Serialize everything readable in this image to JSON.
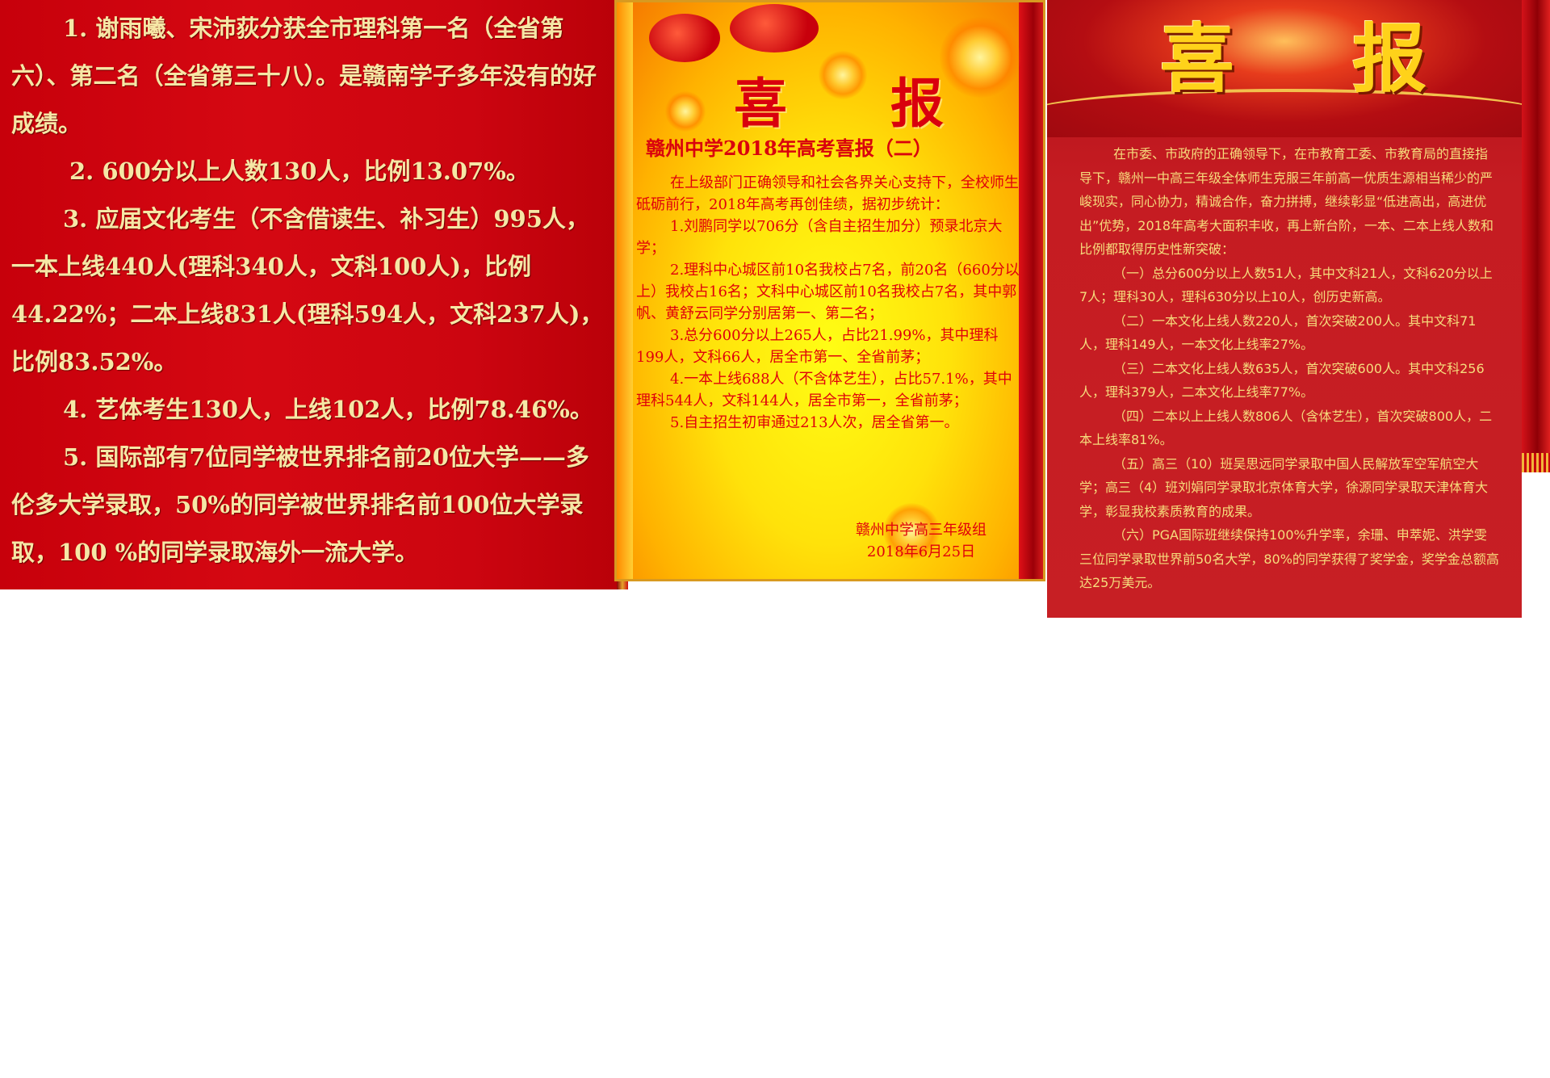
{
  "panel1": {
    "lines": [
      "1. 谢雨曦、宋沛荻分获全市理科第一名（全省第六）、第二名（全省第三十八）。是赣南学子多年没有的好成绩。",
      "2. 600分以上人数130人，比例13.07%。",
      "3. 应届文化考生（不含借读生、补习生）995人，一本上线440人(理科340人，文科100人)，比例44.22%；二本上线831人(理科594人，文科237人)，比例83.52%。",
      "4. 艺体考生130人，上线102人，比例78.46%。",
      "5. 国际部有7位同学被世界排名前20位大学——多伦多大学录取，50%的同学被世界排名前100位大学录取，100 %的同学录取海外一流大学。"
    ]
  },
  "panel2": {
    "header": [
      "喜",
      "报"
    ],
    "subtitle": "赣州中学2018年高考喜报（二）",
    "paragraphs": [
      "在上级部门正确领导和社会各界关心支持下，全校师生砥砺前行，2018年高考再创佳绩，据初步统计：",
      "1.刘鹏同学以706分（含自主招生加分）预录北京大学；",
      "2.理科中心城区前10名我校占7名，前20名（660分以上）我校占16名；文科中心城区前10名我校占7名，其中郭帆、黄舒云同学分别居第一、第二名；",
      "3.总分600分以上265人，占比21.99%，其中理科199人，文科66人，居全市第一、全省前茅；",
      "4.一本上线688人（不含体艺生），占比57.1%，其中理科544人，文科144人，居全市第一，全省前茅；",
      "5.自主招生初审通过213人次，居全省第一。"
    ],
    "signature": "赣州中学高三年级组",
    "date": "2018年6月25日"
  },
  "panel3": {
    "header": [
      "喜",
      "报"
    ],
    "paragraphs": [
      "在市委、市政府的正确领导下，在市教育工委、市教育局的直接指导下，赣州一中高三年级全体师生克服三年前高一优质生源相当稀少的严峻现实，同心协力，精诚合作，奋力拼搏，继续彰显“低进高出，高进优出”优势，2018年高考大面积丰收，再上新台阶，一本、二本上线人数和比例都取得历史性新突破：",
      "（一）总分600分以上人数51人，其中文科21人，文科620分以上7人；理科30人，理科630分以上10人，创历史新高。",
      "（二）一本文化上线人数220人，首次突破200人。其中文科71人，理科149人，一本文化上线率27%。",
      "（三）二本文化上线人数635人，首次突破600人。其中文科256人，理科379人，二本文化上线率77%。",
      "（四）二本以上上线人数806人（含体艺生），首次突破800人，二本上线率81%。",
      "（五）高三（10）班吴思远同学录取中国人民解放军空军航空大学；高三（4）班刘娟同学录取北京体育大学，徐源同学录取天津体育大学，彰显我校素质教育的成果。",
      "（六）PGA国际班继续保持100%升学率，余珊、申萃妮、洪学雯三位同学录取世界前50名大学，80%的同学获得了奖学金，奖学金总额高达25万美元。"
    ]
  },
  "colors": {
    "panel1_bg": "#d50812",
    "panel1_text": "#f6e7a6",
    "panel2_text": "#e0000b",
    "panel3_bg": "#c51c22",
    "panel3_text": "#f6dc7c",
    "panel3_title": "#ffd21a"
  }
}
